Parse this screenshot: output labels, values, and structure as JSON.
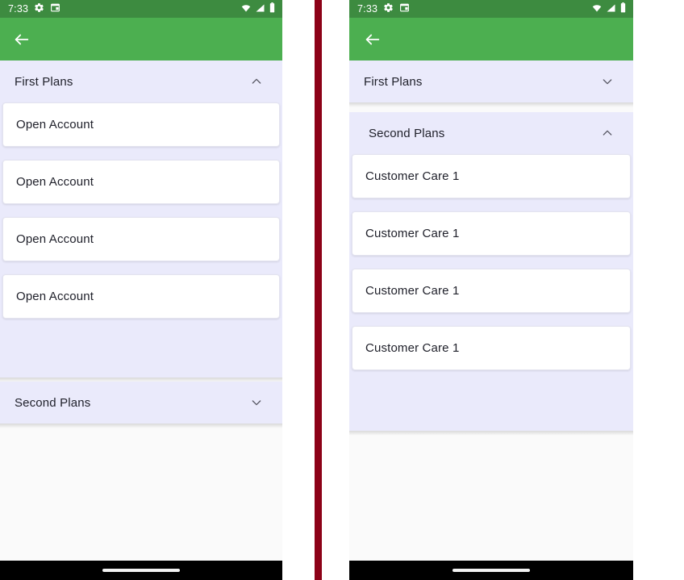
{
  "status_bar": {
    "time": "7:33",
    "icons_left": [
      "gear-icon",
      "screenshot-icon"
    ],
    "icons_right": [
      "wifi-icon",
      "signal-icon",
      "battery-icon"
    ],
    "background_color": "#3d8b40"
  },
  "app_bar": {
    "back_icon": "back-arrow-icon",
    "background_color": "#4CAF50"
  },
  "colors": {
    "accent_green": "#4CAF50",
    "panel_lavender": "#eaeafb",
    "card_white": "#ffffff",
    "divider_red": "#8c0117",
    "text_primary": "#20212b",
    "nav_black": "#000000"
  },
  "left_screen": {
    "panels": [
      {
        "title": "First Plans",
        "expanded": true,
        "chevron": "chevron-up-icon",
        "items": [
          {
            "label": "Open Account"
          },
          {
            "label": "Open Account"
          },
          {
            "label": "Open Account"
          },
          {
            "label": "Open Account"
          }
        ]
      },
      {
        "title": "Second Plans",
        "expanded": false,
        "chevron": "chevron-down-icon",
        "items": []
      }
    ]
  },
  "right_screen": {
    "panels": [
      {
        "title": "First Plans",
        "expanded": false,
        "chevron": "chevron-down-icon",
        "items": []
      },
      {
        "title": "Second Plans",
        "expanded": true,
        "chevron": "chevron-up-icon",
        "items": [
          {
            "label": "Customer Care 1"
          },
          {
            "label": "Customer Care 1"
          },
          {
            "label": "Customer Care 1"
          },
          {
            "label": "Customer Care 1"
          }
        ]
      }
    ]
  },
  "nav_bar": {
    "home_indicator": "home-indicator-pill"
  }
}
